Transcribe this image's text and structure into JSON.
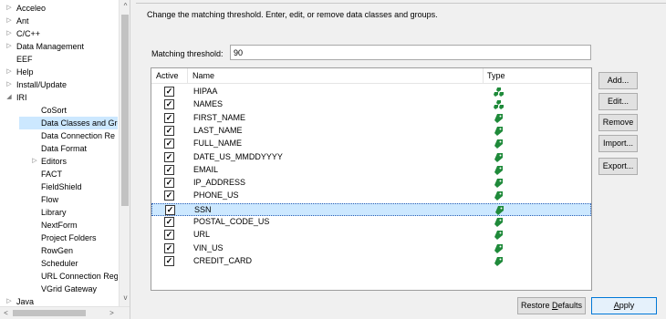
{
  "tree": {
    "items": [
      {
        "label": "Acceleo",
        "expander": "▷",
        "level": 0
      },
      {
        "label": "Ant",
        "expander": "▷",
        "level": 0
      },
      {
        "label": "C/C++",
        "expander": "▷",
        "level": 0
      },
      {
        "label": "Data Management",
        "expander": "▷",
        "level": 0
      },
      {
        "label": "EEF",
        "expander": "",
        "level": 0
      },
      {
        "label": "Help",
        "expander": "▷",
        "level": 0
      },
      {
        "label": "Install/Update",
        "expander": "▷",
        "level": 0
      },
      {
        "label": "IRI",
        "expander": "◢",
        "level": 0
      },
      {
        "label": "CoSort",
        "expander": "",
        "level": 1
      },
      {
        "label": "Data Classes and Gro",
        "expander": "",
        "level": 1
      },
      {
        "label": "Data Connection Re",
        "expander": "",
        "level": 1
      },
      {
        "label": "Data Format",
        "expander": "",
        "level": 1
      },
      {
        "label": "Editors",
        "expander": "▷",
        "level": 1
      },
      {
        "label": "FACT",
        "expander": "",
        "level": 1
      },
      {
        "label": "FieldShield",
        "expander": "",
        "level": 1
      },
      {
        "label": "Flow",
        "expander": "",
        "level": 1
      },
      {
        "label": "Library",
        "expander": "",
        "level": 1
      },
      {
        "label": "NextForm",
        "expander": "",
        "level": 1
      },
      {
        "label": "Project Folders",
        "expander": "",
        "level": 1
      },
      {
        "label": "RowGen",
        "expander": "",
        "level": 1
      },
      {
        "label": "Scheduler",
        "expander": "",
        "level": 1
      },
      {
        "label": "URL Connection Reg",
        "expander": "",
        "level": 1
      },
      {
        "label": "VGrid Gateway",
        "expander": "",
        "level": 1
      },
      {
        "label": "Java",
        "expander": "▷",
        "level": 0
      }
    ],
    "selected_index": 9,
    "scroll_up": "^",
    "scroll_down": "v",
    "scroll_left": "<",
    "scroll_right": ">"
  },
  "main": {
    "description": "Change the matching threshold. Enter, edit, or remove data classes and groups.",
    "threshold_label": "Matching threshold:",
    "threshold_value": "90",
    "table": {
      "columns": [
        "Active",
        "Name",
        "Type"
      ],
      "rows": [
        {
          "active": true,
          "name": "HIPAA",
          "type": "group-icon"
        },
        {
          "active": true,
          "name": "NAMES",
          "type": "group-icon"
        },
        {
          "active": true,
          "name": "FIRST_NAME",
          "type": "tag-icon"
        },
        {
          "active": true,
          "name": "LAST_NAME",
          "type": "tag-icon"
        },
        {
          "active": true,
          "name": "FULL_NAME",
          "type": "tag-icon"
        },
        {
          "active": true,
          "name": "DATE_US_MMDDYYYY",
          "type": "tag-icon"
        },
        {
          "active": true,
          "name": "EMAIL",
          "type": "tag-icon"
        },
        {
          "active": true,
          "name": "IP_ADDRESS",
          "type": "tag-icon"
        },
        {
          "active": true,
          "name": "PHONE_US",
          "type": "tag-icon"
        },
        {
          "active": true,
          "name": "SSN",
          "type": "tag-icon"
        },
        {
          "active": true,
          "name": "POSTAL_CODE_US",
          "type": "tag-icon"
        },
        {
          "active": true,
          "name": "URL",
          "type": "tag-icon"
        },
        {
          "active": true,
          "name": "VIN_US",
          "type": "tag-icon"
        },
        {
          "active": true,
          "name": "CREDIT_CARD",
          "type": "tag-icon"
        }
      ],
      "selected_index": 9
    },
    "buttons": {
      "add": "Add...",
      "edit": "Edit...",
      "remove": "Remove",
      "import": "Import...",
      "export": "Export..."
    },
    "footer": {
      "restore_defaults_prefix": "Restore ",
      "restore_defaults_mnemonic": "D",
      "restore_defaults_suffix": "efaults",
      "apply_mnemonic": "A",
      "apply_suffix": "pply"
    }
  },
  "colors": {
    "tag_green": "#1f8a3a",
    "selection": "#cce8ff",
    "default_button_border": "#0078d7"
  }
}
